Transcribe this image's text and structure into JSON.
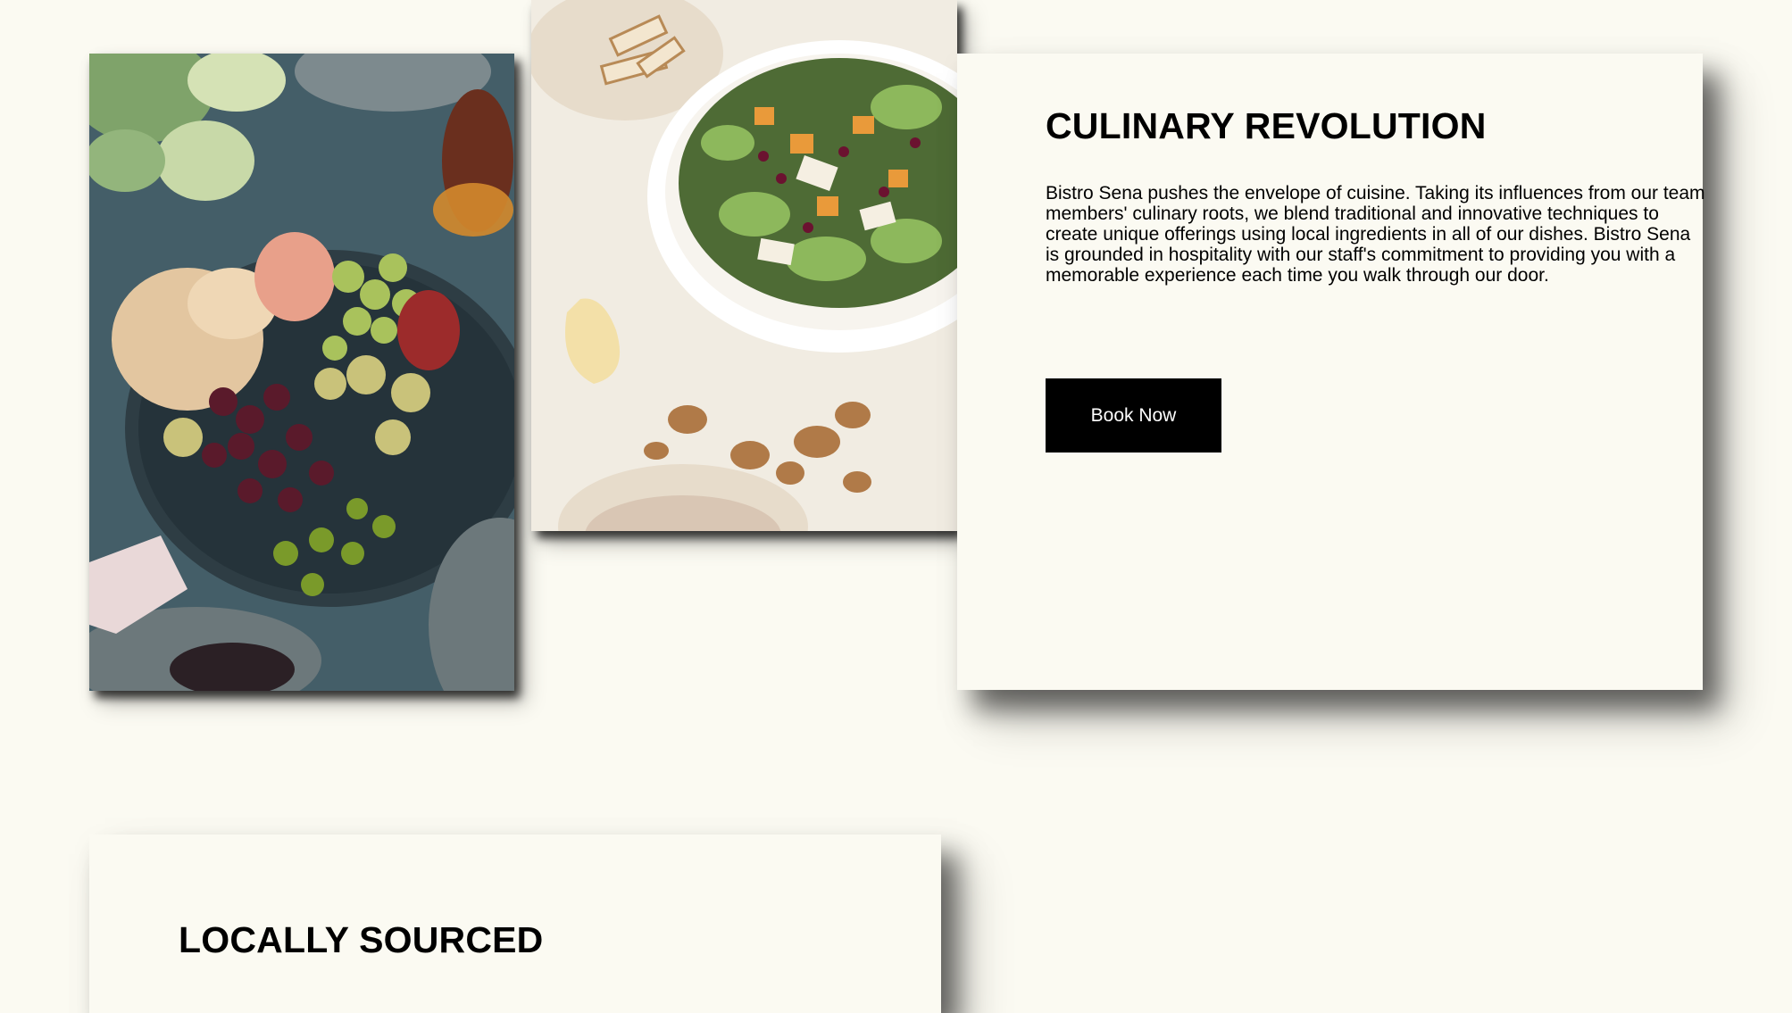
{
  "sections": {
    "culinary": {
      "title": "CULINARY REVOLUTION",
      "body": "Bistro Sena pushes the envelope of cuisine. Taking its influences from our team members' culinary roots, we blend traditional and innovative techniques to create unique offerings using local ingredients in all of our dishes. Bistro Sena is grounded in hospitality with our staff's commitment to providing you with a memorable experience each time you walk through our door.",
      "button_label": "Book Now"
    },
    "local": {
      "title": "LOCALLY SOURCED"
    }
  },
  "colors": {
    "page_background": "#fbfaf2",
    "button_background": "#000000",
    "button_text": "#ffffff"
  }
}
